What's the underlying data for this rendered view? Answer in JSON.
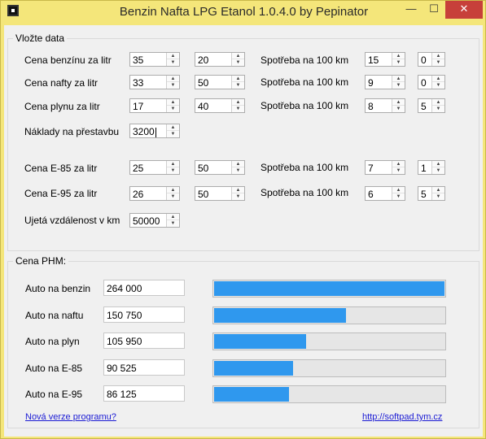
{
  "window": {
    "title": "Benzin Nafta LPG Etanol 1.0.4.0 by Pepinator",
    "minimize_label": "—",
    "maximize_label": "☐",
    "close_label": "✕"
  },
  "input_group": {
    "label": "Vložte data",
    "rows": [
      {
        "label": "Cena benzínu za litr",
        "price": "35",
        "extra": "20",
        "consumption_label": "Spotřeba na 100 km",
        "cons_main": "15",
        "cons_dec": "0"
      },
      {
        "label": "Cena nafty za litr",
        "price": "33",
        "extra": "50",
        "consumption_label": "Spotřeba na 100 km",
        "cons_main": "9",
        "cons_dec": "0"
      },
      {
        "label": "Cena plynu  za litr",
        "price": "17",
        "extra": "40",
        "consumption_label": "Spotřeba na 100 km",
        "cons_main": "8",
        "cons_dec": "5"
      },
      {
        "label": "Cena E-85 za litr",
        "price": "25",
        "extra": "50",
        "consumption_label": "Spotřeba na 100 km",
        "cons_main": "7",
        "cons_dec": "1"
      },
      {
        "label": "Cena E-95 za litr",
        "price": "26",
        "extra": "50",
        "consumption_label": "Spotřeba na 100 km",
        "cons_main": "6",
        "cons_dec": "5"
      }
    ],
    "conversion": {
      "label": "Náklady na přestavbu",
      "value": "3200"
    },
    "distance": {
      "label": "Ujetá vzdálenost v km",
      "value": "50000"
    }
  },
  "results_group": {
    "label": "Cena PHM:",
    "rows": [
      {
        "label": "Auto na benzin",
        "value": "264 000",
        "fraction": 1.0
      },
      {
        "label": "Auto na naftu",
        "value": "150 750",
        "fraction": 0.571
      },
      {
        "label": "Auto na plyn",
        "value": "105 950",
        "fraction": 0.401
      },
      {
        "label": "Auto na E-85",
        "value": "90 525",
        "fraction": 0.343
      },
      {
        "label": "Auto na E-95",
        "value": "86 125",
        "fraction": 0.326
      }
    ]
  },
  "links": {
    "new_version": "Nová verze programu?",
    "homepage": "http://softpad.tym.cz"
  },
  "colors": {
    "bar": "#2f98ee",
    "titlebar": "#f4e67a",
    "close": "#c7403a"
  }
}
